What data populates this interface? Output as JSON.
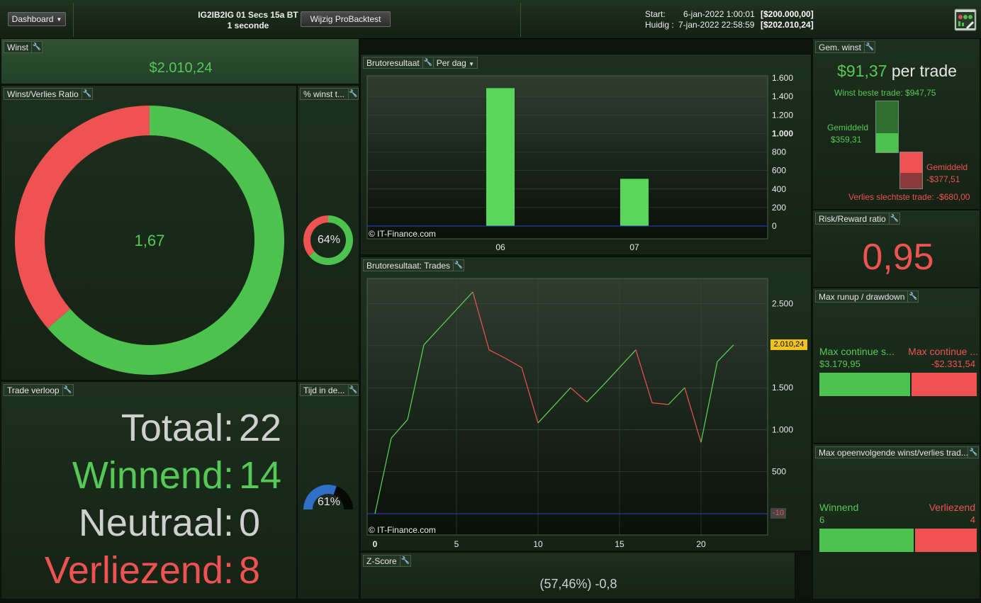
{
  "header": {
    "dashboard_label": "Dashboard",
    "strategy_name": "IG2IB2IG 01 Secs 15a BT",
    "timeframe": "1 seconde",
    "edit_backtest_label": "Wijzig ProBacktest",
    "start_label": "Start:",
    "start_date": "6-jan-2022 1:00:01",
    "start_capital": "[$200.000,00]",
    "current_label": "Huidig :",
    "current_date": "7-jan-2022 22:58:59",
    "current_capital": "[$202.010,24]"
  },
  "winst": {
    "title": "Winst",
    "value": "$2.010,24"
  },
  "ratio": {
    "title": "Winst/Verlies Ratio",
    "value": "1,67",
    "win_fraction": 0.6364
  },
  "pct_winst": {
    "title": "% winst t...",
    "value": "64%",
    "fraction": 0.64
  },
  "trade_verloop": {
    "title": "Trade verloop",
    "rows": [
      {
        "label": "Totaal:",
        "value": "22"
      },
      {
        "label": "Winnend:",
        "value": "14"
      },
      {
        "label": "Neutraal:",
        "value": "0"
      },
      {
        "label": "Verliezend:",
        "value": "8"
      }
    ]
  },
  "tijd": {
    "title": "Tijd in de...",
    "value": "61%",
    "fraction": 0.61
  },
  "bruto_dag": {
    "title": "Brutoresultaat",
    "dropdown": "Per dag",
    "watermark": "© IT-Finance.com"
  },
  "bruto_trades": {
    "title": "Brutoresultaat: Trades",
    "watermark": "© IT-Finance.com",
    "last_value_label": "2.010,24",
    "zero_label": "-10"
  },
  "zscore": {
    "title": "Z-Score",
    "value": "(57,46%) -0,8"
  },
  "gem_winst": {
    "title": "Gem. winst",
    "value": "$91,37",
    "suffix": "per trade",
    "best_trade": "Winst beste trade: $947,75",
    "avg_win_label": "Gemiddeld",
    "avg_win_value": "$359,31",
    "avg_loss_label": "Gemiddeld",
    "avg_loss_value": "-$377,51",
    "worst_trade": "Verlies slechtste trade: -$680,00"
  },
  "risk_reward": {
    "title": "Risk/Reward ratio",
    "value": "0,95"
  },
  "runup": {
    "title": "Max runup / drawdown",
    "left_label": "Max continue s...",
    "left_value": "$3.179,95",
    "right_label": "Max continue ...",
    "right_value": "-$2.331,54",
    "runup_fraction": 0.577
  },
  "consec": {
    "title": "Max opeenvolgende winst/verlies trad...",
    "win_label": "Winnend",
    "win_value": "6",
    "loss_label": "Verliezend",
    "loss_value": "4",
    "win_fraction": 0.6
  },
  "colors": {
    "green": "#56c856",
    "red": "#ee5252",
    "grey": "#cfcfcf",
    "blue": "#2f6fc8"
  },
  "chart_data": [
    {
      "type": "bar",
      "title": "Brutoresultaat",
      "categories": [
        "06",
        "07"
      ],
      "values": [
        1490,
        510
      ],
      "ylim": [
        0,
        1600
      ],
      "yticks": [
        "0",
        "200",
        "400",
        "600",
        "800",
        "1.000",
        "1.200",
        "1.400",
        "1.600"
      ]
    },
    {
      "type": "line",
      "title": "Brutoresultaat: Trades",
      "x": [
        0,
        1,
        2,
        3,
        4,
        5,
        6,
        7,
        8,
        9,
        10,
        11,
        12,
        13,
        14,
        15,
        16,
        17,
        18,
        19,
        20,
        21,
        22
      ],
      "values": [
        0,
        900,
        1120,
        2010,
        2220,
        2430,
        2640,
        1950,
        1850,
        1740,
        1080,
        1290,
        1500,
        1330,
        1530,
        1740,
        1950,
        1320,
        1300,
        1500,
        850,
        1810,
        2010
      ],
      "ylim": [
        -10,
        2800
      ],
      "xticks": [
        "0",
        "5",
        "10",
        "15",
        "20"
      ],
      "yticks": [
        "500",
        "1.000",
        "1.500",
        "2.000",
        "2.500"
      ]
    }
  ]
}
